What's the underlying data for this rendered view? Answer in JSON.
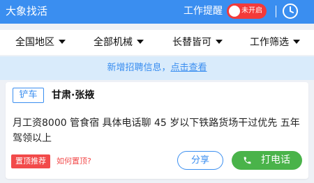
{
  "topbar": {
    "app_title": "大象找活",
    "remind_label": "工作提醒",
    "toggle_label": "未开启",
    "clock_icon": "clock-icon"
  },
  "filters": [
    {
      "label": "全国地区"
    },
    {
      "label": "全部机械"
    },
    {
      "label": "长替皆可"
    },
    {
      "label": "工作筛选"
    }
  ],
  "banner": {
    "text": "新增招聘信息，",
    "link": "点击查看"
  },
  "job": {
    "tag": "铲车",
    "location": "甘肃·张掖",
    "description": "月工资8000 管食宿 具体电话聊 45 岁以下铁路货场干过优先 五年驾领以上",
    "top_badge": "置顶推荐",
    "how_top": "如何置顶?",
    "share_label": "分享",
    "call_label": "打电话"
  },
  "colors": {
    "primary": "#3a8ef0",
    "toggle_red": "#f33a3a",
    "call_green": "#4ab34a",
    "badge_red": "#f24a4a",
    "banner_bg": "#d9ebfb"
  }
}
